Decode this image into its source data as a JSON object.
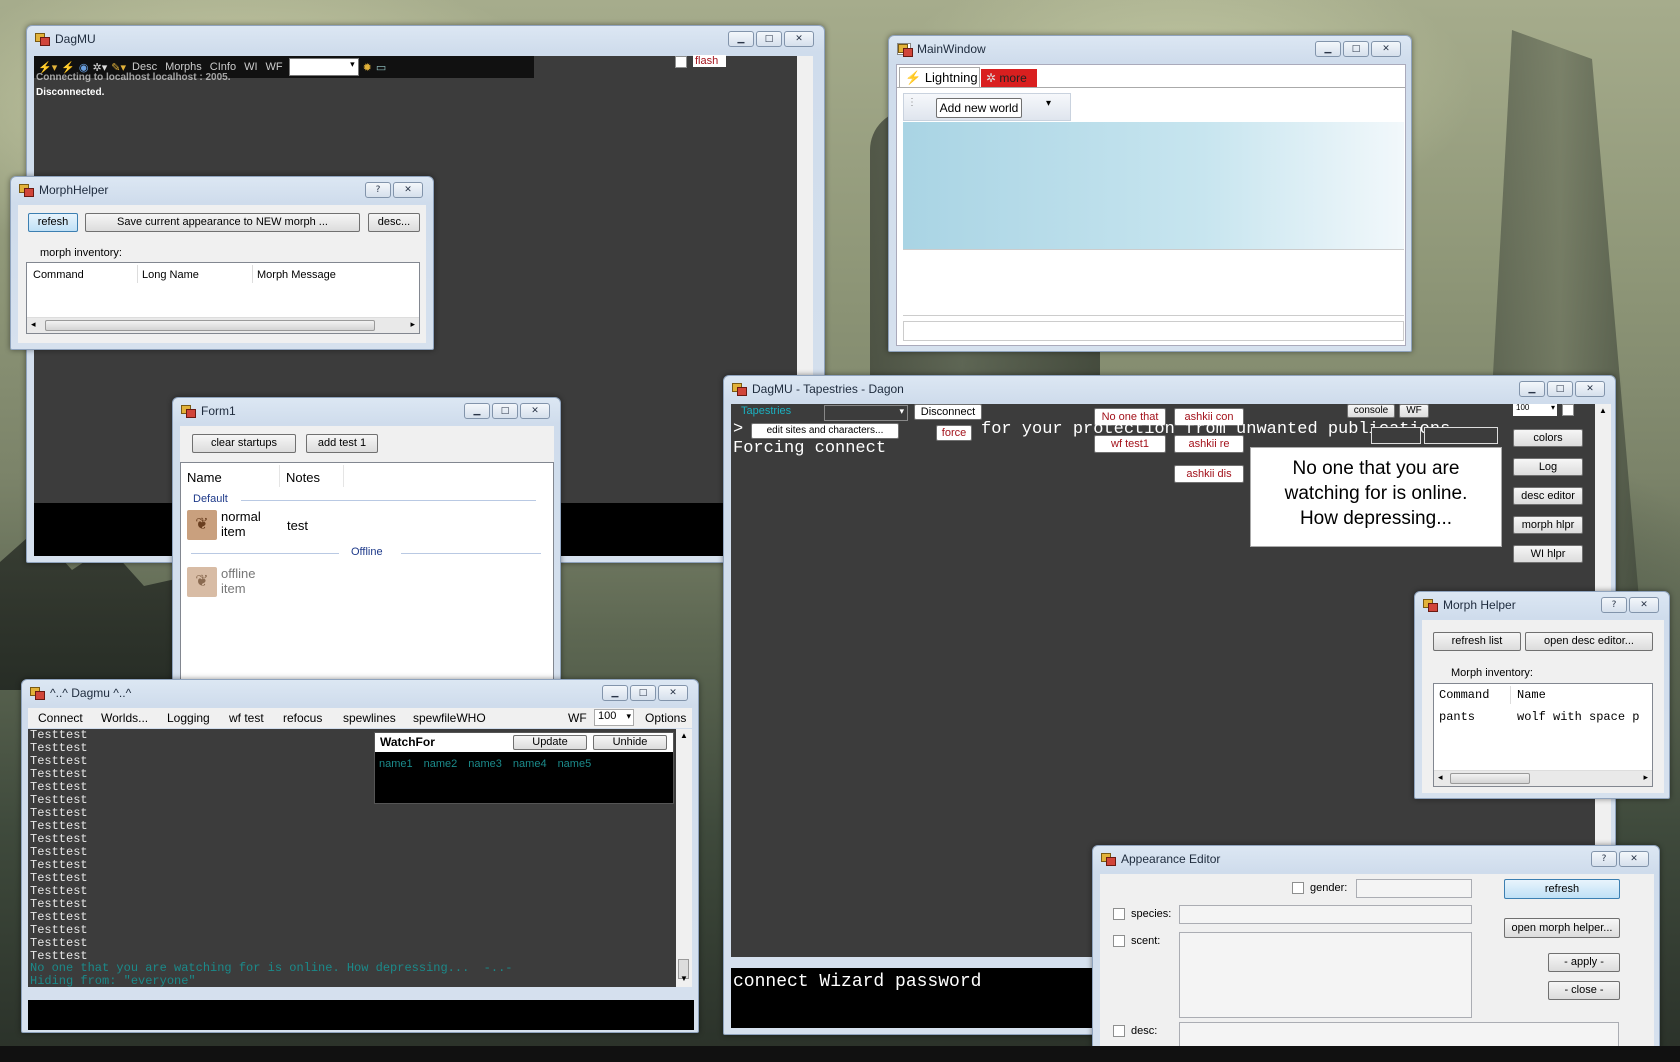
{
  "colors": {
    "accent": "#3c7fb1",
    "terminal_bg": "#3c3c3c",
    "teal_text": "#1b8a8a",
    "red_text": "#a3121b"
  },
  "icons": {
    "minimize": "minimize-icon",
    "maximize": "maximize-icon",
    "close": "close-icon",
    "help": "help-icon"
  },
  "win_dagmu_main": {
    "title": "DagMU",
    "toolbar": {
      "desc": "Desc",
      "morphs": "Morphs",
      "cinfo": "CInfo",
      "wi": "WI",
      "wf": "WF"
    },
    "flash_label": "flash",
    "log": [
      "Connecting to localhost localhost : 2005.",
      "Disconnected."
    ]
  },
  "win_morphhelper": {
    "title": "MorphHelper",
    "help": "?",
    "close": "✕",
    "refresh": "refesh",
    "save": "Save current appearance to NEW morph ...",
    "desc": "desc...",
    "inventory_label": "morph inventory:",
    "columns": [
      "Command",
      "Long Name",
      "Morph Message"
    ]
  },
  "win_form1": {
    "title": "Form1",
    "clear": "clear startups",
    "add": "add test 1",
    "columns": [
      "Name",
      "Notes"
    ],
    "group_default": "Default",
    "group_offline": "Offline",
    "item1": {
      "name": "normal item",
      "notes": "test"
    },
    "item2": {
      "name": "offline item"
    }
  },
  "win_dagmu_small": {
    "title": "^..^ Dagmu ^..^",
    "menu": [
      "Connect",
      "Worlds...",
      "Logging",
      "wf test",
      "refocus",
      "spewlines",
      "spewfileWHO"
    ],
    "wf": "WF",
    "num": "100",
    "options": "Options",
    "lines": [
      "Testtest",
      "Testtest",
      "Testtest",
      "Testtest",
      "Testtest",
      "Testtest",
      "Testtest",
      "Testtest",
      "Testtest",
      "Testtest",
      "Testtest",
      "Testtest",
      "Testtest",
      "Testtest",
      "Testtest",
      "Testtest",
      "Testtest",
      "Testtest"
    ],
    "status1": "No one that you are watching for is online. How depressing...  -..-",
    "status2": "Hiding from: \"everyone\"",
    "watch": {
      "title": "WatchFor",
      "update": "Update",
      "unhide": "Unhide",
      "names": [
        "name1",
        "name2",
        "name3",
        "name4",
        "name5"
      ]
    }
  },
  "win_mainwindow": {
    "title": "MainWindow",
    "tab1": "Lightning",
    "tab2": "more",
    "add_world": "Add new world"
  },
  "win_tapestries": {
    "title": "DagMU - Tapestries - Dagon",
    "tapestries": "Tapestries",
    "disconnect": "Disconnect",
    "no_one": "No one that",
    "ashkii_con": "ashkii con",
    "console": "console",
    "wf": "WF",
    "num": "100",
    "edit_sites": "edit sites and characters...",
    "force": "force",
    "wf_test1": "wf test1",
    "ashkii_re": "ashkii re",
    "ashkii_dis": "ashkii dis",
    "line1_prefix": ">",
    "line1": "out for your protection from unwanted publications",
    "line1_tail": "for your protection from unwanted publications",
    "line2": "Forcing connect",
    "popup": "No one that you are watching for is online. How depressing...",
    "side": [
      "colors",
      "Log",
      "desc editor",
      "morph hlpr",
      "WI hlpr"
    ],
    "input": "connect Wizard password"
  },
  "win_morph2": {
    "title": "Morph Helper",
    "help": "?",
    "close": "✕",
    "refresh": "refresh list",
    "open_desc": "open desc editor...",
    "inventory_label": "Morph inventory:",
    "columns": [
      "Command",
      "Name"
    ],
    "row": {
      "command": "pants",
      "name": "wolf with space p"
    }
  },
  "win_appearance": {
    "title": "Appearance Editor",
    "help": "?",
    "close": "✕",
    "gender": "gender:",
    "species": "species:",
    "scent": "scent:",
    "desc": "desc:",
    "refresh": "refresh",
    "open_morph": "open morph helper...",
    "apply": "- apply -",
    "close_btn": "- close -"
  }
}
